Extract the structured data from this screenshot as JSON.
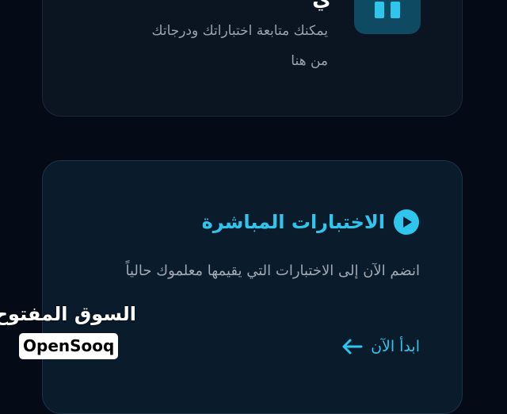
{
  "top_card": {
    "title_partial": "ي",
    "description": "يمكنك متابعة اختباراتك ودرجاتك من هنا",
    "icon": "book-icon"
  },
  "live_card": {
    "icon": "play-icon",
    "title": "الاختبارات المباشرة",
    "description": "انضم الآن إلى الاختبارات التي يقيمها معلموك حالياً",
    "start_label": "ابدأ الآن",
    "start_icon": "arrow-left-icon"
  },
  "watermark": {
    "arabic": "السوق المفتوح",
    "latin": "OpenSooq"
  },
  "colors": {
    "background": "#040b16",
    "accent": "#2ec6ec",
    "card_dark": "#0b1421",
    "card_live": "#0a1b2c",
    "icon_tile": "#0f4a63"
  }
}
